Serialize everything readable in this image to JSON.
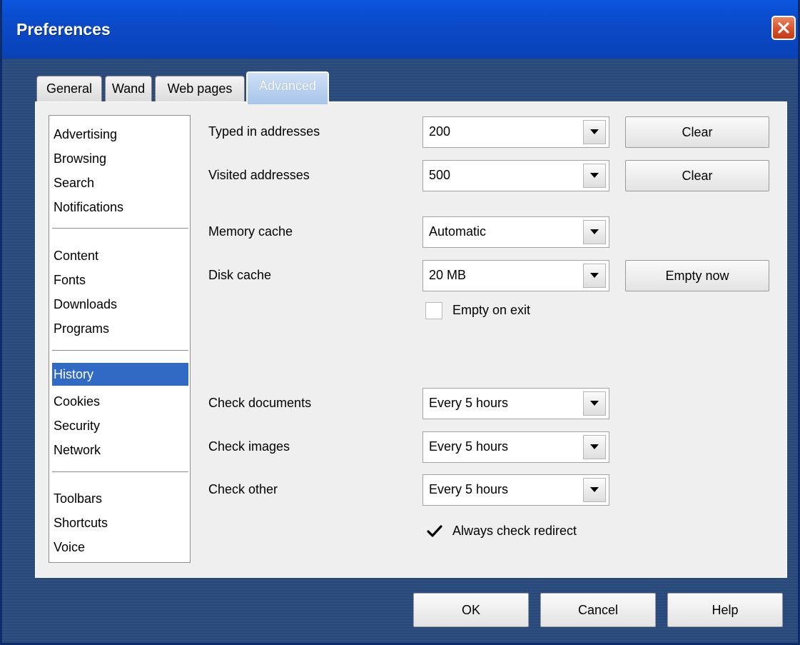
{
  "window": {
    "title": "Preferences"
  },
  "tabs": [
    {
      "label": "General"
    },
    {
      "label": "Wand"
    },
    {
      "label": "Web pages"
    },
    {
      "label": "Advanced",
      "active": true
    }
  ],
  "sidebar": {
    "groups": [
      [
        "Advertising",
        "Browsing",
        "Search",
        "Notifications"
      ],
      [
        "Content",
        "Fonts",
        "Downloads",
        "Programs"
      ],
      [
        "History",
        "Cookies",
        "Security",
        "Network"
      ],
      [
        "Toolbars",
        "Shortcuts",
        "Voice"
      ]
    ],
    "selected": "History"
  },
  "history": {
    "typed_addresses": {
      "label": "Typed in addresses",
      "value": "200",
      "button": "Clear"
    },
    "visited_addresses": {
      "label": "Visited addresses",
      "value": "500",
      "button": "Clear"
    },
    "memory_cache": {
      "label": "Memory cache",
      "value": "Automatic"
    },
    "disk_cache": {
      "label": "Disk cache",
      "value": "20 MB",
      "button": "Empty now"
    },
    "empty_on_exit": {
      "label": "Empty on exit",
      "checked": false
    },
    "check_documents": {
      "label": "Check documents",
      "value": "Every 5 hours"
    },
    "check_images": {
      "label": "Check images",
      "value": "Every 5 hours"
    },
    "check_other": {
      "label": "Check other",
      "value": "Every 5 hours"
    },
    "always_check_redirect": {
      "label": "Always check redirect",
      "checked": true
    }
  },
  "footer": {
    "ok": "OK",
    "cancel": "Cancel",
    "help": "Help"
  },
  "colors": {
    "titlebar": "#0a49c7",
    "selection": "#316ac5",
    "close_button": "#d9502a",
    "panel": "#efefef"
  },
  "icons": {
    "close": "close-x-icon",
    "dropdown": "chevron-down-icon",
    "check": "checkmark-icon"
  }
}
